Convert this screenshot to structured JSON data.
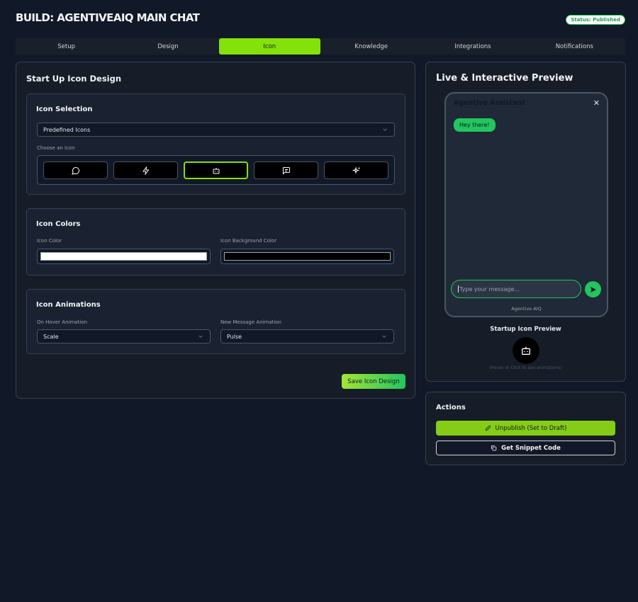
{
  "header": {
    "title": "BUILD: AGENTIVEAIQ MAIN CHAT",
    "status": "Status: Published"
  },
  "tabs": [
    {
      "label": "Setup"
    },
    {
      "label": "Design"
    },
    {
      "label": "Icon",
      "active": true
    },
    {
      "label": "Knowledge"
    },
    {
      "label": "Integrations"
    },
    {
      "label": "Notifications"
    }
  ],
  "design": {
    "title": "Start Up Icon Design",
    "selection": {
      "title": "Icon Selection",
      "type_value": "Predefined Icons",
      "choose_label": "Choose an Icon",
      "icons": [
        "chat-bubble-icon",
        "lightning-icon",
        "robot-icon",
        "message-square-icon",
        "sparkles-icon"
      ],
      "selected_icon": "robot-icon"
    },
    "colors": {
      "title": "Icon Colors",
      "icon_color_label": "Icon Color",
      "icon_color": "#ffffff",
      "bg_color_label": "Icon Background Color",
      "bg_color": "#000000"
    },
    "animations": {
      "title": "Icon Animations",
      "hover_label": "On Hover Animation",
      "hover_value": "Scale",
      "new_msg_label": "New Message Animation",
      "new_msg_value": "Pulse"
    },
    "save_label": "Save Icon Design"
  },
  "preview": {
    "title": "Live & Interactive Preview",
    "assistant_name": "Agentive Assistant",
    "close": "✕",
    "greeting": "Hey there!",
    "input_placeholder": "Type your message...",
    "footer": "Agentive AIQ",
    "startup_title": "Startup Icon Preview",
    "startup_hint": "(Hover or Click to see animations)"
  },
  "actions": {
    "title": "Actions",
    "unpublish_label": "Unpublish (Set to Draft)",
    "snippet_label": "Get Snippet Code"
  },
  "colors": {
    "accent": "#84e10a",
    "success": "#22c55e",
    "background": "#111827",
    "panel": "#161d29"
  }
}
